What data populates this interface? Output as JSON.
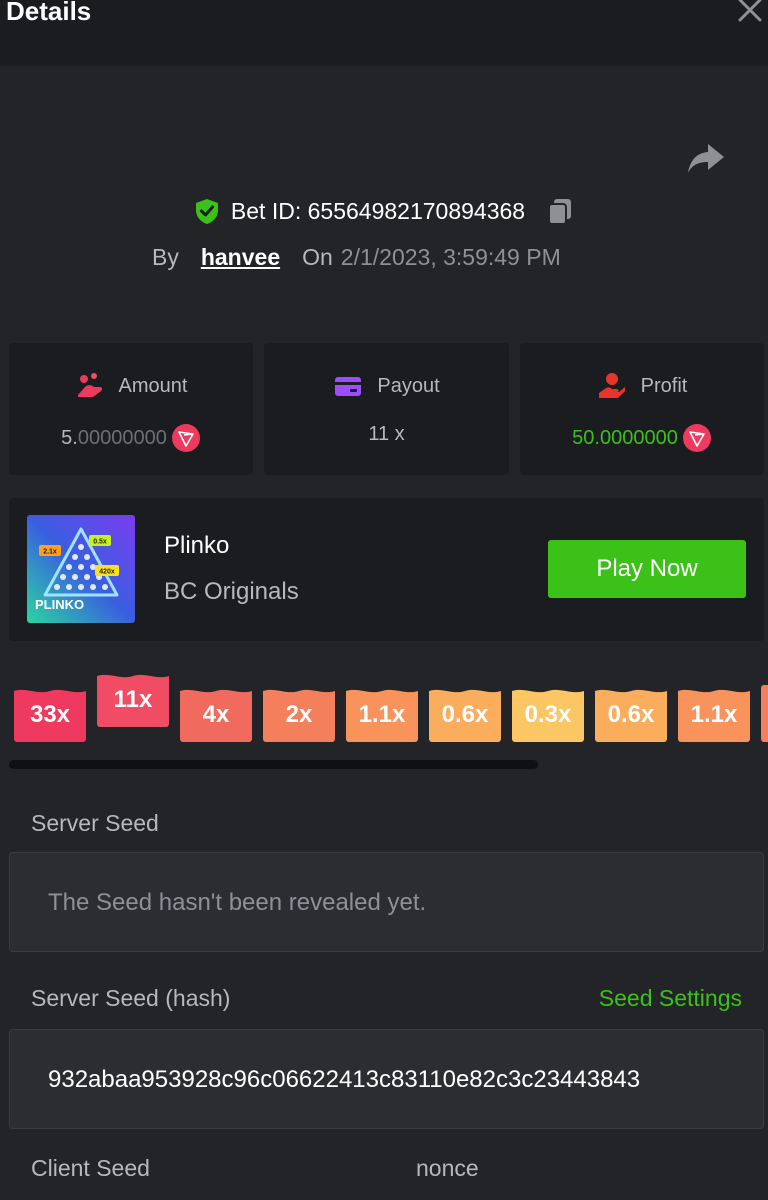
{
  "header": {
    "title": "Details",
    "close_icon": "close-icon"
  },
  "bet": {
    "id_text": "Bet ID: 6556498217089436​8",
    "by_label": "By",
    "username": "hanvee",
    "on_label": "On",
    "date": "2/1/2023, 3:59:49 PM"
  },
  "stats": {
    "amount": {
      "label": "Amount",
      "value_main": "5.",
      "value_dim": "00000000",
      "icon": "coins-hand-icon"
    },
    "payout": {
      "label": "Payout",
      "value": "11 x",
      "icon": "card-icon"
    },
    "profit": {
      "label": "Profit",
      "value": "50.0000000",
      "icon": "hand-coin-icon"
    }
  },
  "game": {
    "thumb_text": "PLINKO",
    "thumb_tags": [
      "2.1x",
      "0.5x",
      "420x"
    ],
    "name": "Plinko",
    "provider": "BC Originals",
    "play_label": "Play Now"
  },
  "multipliers": [
    {
      "label": "33x",
      "color": "#ee3a5e"
    },
    {
      "label": "11x",
      "color": "#f04c63"
    },
    {
      "label": "4x",
      "color": "#f06a5d"
    },
    {
      "label": "2x",
      "color": "#f47f5c"
    },
    {
      "label": "1.1x",
      "color": "#f8935c"
    },
    {
      "label": "0.6x",
      "color": "#fbad5e"
    },
    {
      "label": "0.3x",
      "color": "#fdc664"
    },
    {
      "label": "0.6x",
      "color": "#fbad5e"
    },
    {
      "label": "1.1x",
      "color": "#f8935c"
    }
  ],
  "seeds": {
    "server_seed_label": "Server Seed",
    "server_seed_value": "The Seed hasn't been revealed yet.",
    "server_hash_label": "Server Seed (hash)",
    "seed_settings_label": "Seed Settings",
    "server_hash_value": "932abaa953928c96c06622413c83110e82c3c23443843",
    "client_seed_label": "Client Seed",
    "nonce_label": "nonce"
  },
  "colors": {
    "accent_green": "#3bc117",
    "trx_red": "#ee3a5e"
  }
}
